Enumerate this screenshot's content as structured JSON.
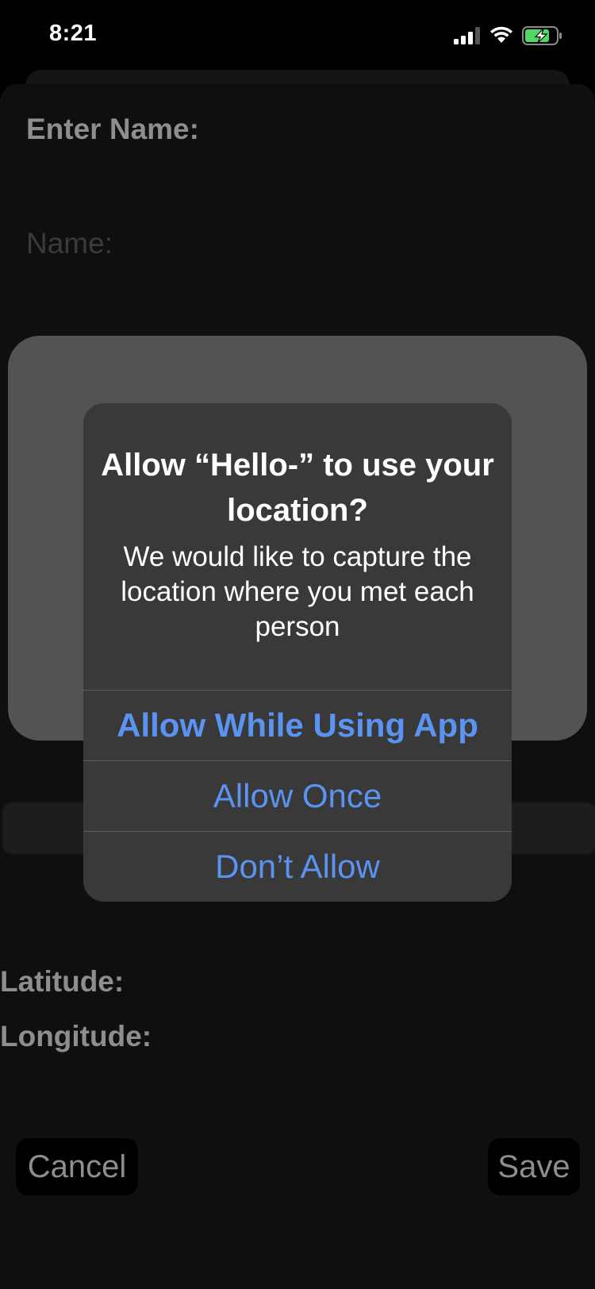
{
  "status_bar": {
    "time": "8:21",
    "icons": [
      "signal-icon",
      "wifi-icon",
      "battery-charging-icon"
    ],
    "battery_color": "#4cd964"
  },
  "form": {
    "enter_name_label": "Enter Name:",
    "name_placeholder": "Name:",
    "latitude_label": "Latitude:",
    "longitude_label": "Longitude:",
    "cancel_label": "Cancel",
    "save_label": "Save"
  },
  "alert": {
    "title": "Allow “Hello-” to use your location?",
    "message": "We would like to capture the location where you met each person",
    "buttons": {
      "allow_while_using": "Allow While Using App",
      "allow_once": "Allow Once",
      "dont_allow": "Don’t Allow"
    },
    "accent_color": "#5a93f1"
  }
}
